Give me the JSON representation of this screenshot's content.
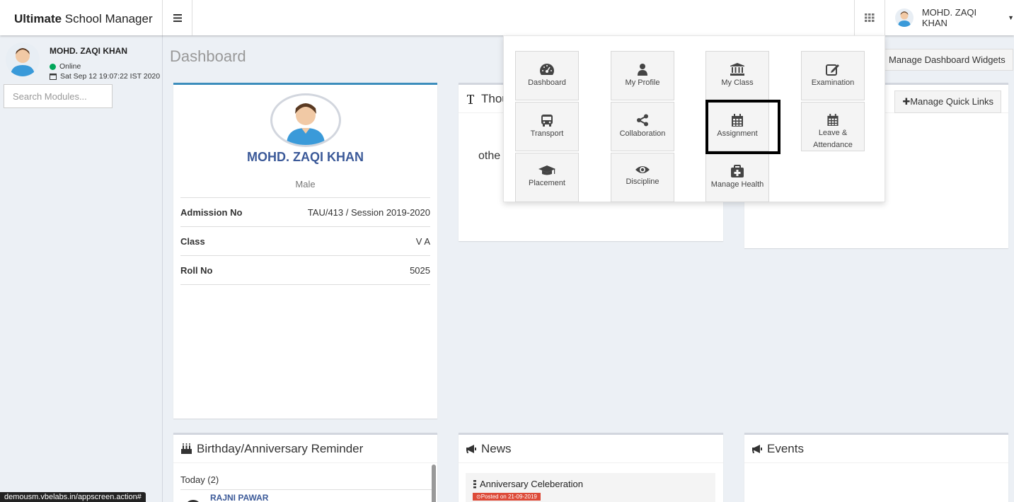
{
  "app": {
    "brand_bold": "Ultimate",
    "brand_rest": " School Manager"
  },
  "header": {
    "user_name": "MOHD. ZAQI KHAN"
  },
  "sidebar": {
    "user_name": "MOHD. ZAQI KHAN",
    "status": "Online",
    "datetime": "Sat Sep 12 19:07:22 IST 2020",
    "search_placeholder": "Search Modules..."
  },
  "page": {
    "title": "Dashboard",
    "manage_widgets": "Manage Dashboard Widgets"
  },
  "profile": {
    "name": "MOHD. ZAQI KHAN",
    "gender": "Male",
    "rows": [
      {
        "label": "Admission No",
        "value": "TAU/413 / Session 2019-2020"
      },
      {
        "label": "Class",
        "value": "V A"
      },
      {
        "label": "Roll No",
        "value": "5025"
      }
    ]
  },
  "thought": {
    "title": "Thou",
    "text": "othe"
  },
  "quick_links": {
    "button": "Manage Quick Links"
  },
  "birthday": {
    "title": "Birthday/Anniversary Reminder",
    "today": "Today (2)",
    "person": "RAJNI PAWAR"
  },
  "news": {
    "title": "News",
    "item_title": "Anniversary Celeberation",
    "item_tag": "Posted on 21-09-2019"
  },
  "events": {
    "title": "Events"
  },
  "apps": [
    {
      "label": "Dashboard",
      "icon": "dashboard-icon"
    },
    {
      "label": "My Profile",
      "icon": "user-icon"
    },
    {
      "label": "My Class",
      "icon": "institution-icon"
    },
    {
      "label": "Examination",
      "icon": "edit-icon"
    },
    {
      "label": "Transport",
      "icon": "bus-icon"
    },
    {
      "label": "Collaboration",
      "icon": "share-icon"
    },
    {
      "label": "Assignment",
      "icon": "calendar-icon"
    },
    {
      "label": "Leave & Attendance",
      "icon": "calendar-icon"
    },
    {
      "label": "Placement",
      "icon": "graduation-cap-icon"
    },
    {
      "label": "Discipline",
      "icon": "eye-icon"
    },
    {
      "label": "Manage Health",
      "icon": "medkit-icon"
    }
  ],
  "status_bar": {
    "url": "demousm.vbelabs.in/appscreen.action#"
  }
}
